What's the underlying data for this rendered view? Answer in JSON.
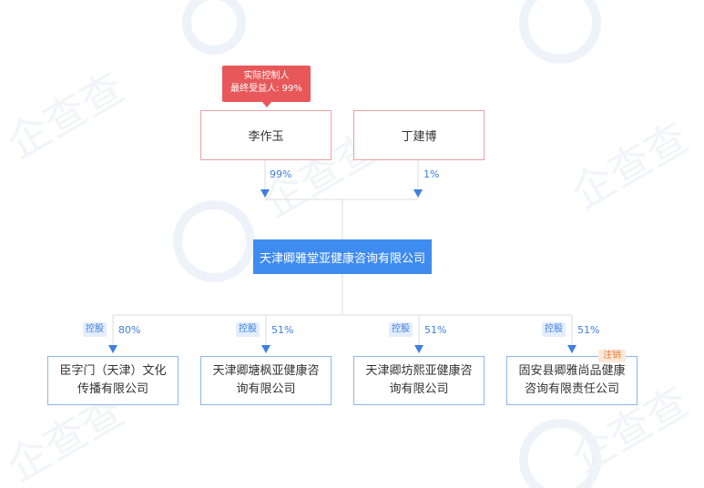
{
  "controller_tag": {
    "line1": "实际控制人",
    "line2": "最终受益人: 99%"
  },
  "shareholders": [
    {
      "name": "李作玉",
      "percent": "99%"
    },
    {
      "name": "丁建博",
      "percent": "1%"
    }
  ],
  "main_company": {
    "name": "天津卿雅堂亚健康咨询有限公司"
  },
  "subsidiaries": [
    {
      "relation": "控股",
      "percent": "80%",
      "name": "臣字门（天津）文化传播有限公司",
      "status": ""
    },
    {
      "relation": "控股",
      "percent": "51%",
      "name": "天津卿塘枫亚健康咨询有限公司",
      "status": ""
    },
    {
      "relation": "控股",
      "percent": "51%",
      "name": "天津卿坊熙亚健康咨询有限公司",
      "status": ""
    },
    {
      "relation": "控股",
      "percent": "51%",
      "name": "固安县卿雅尚品健康咨询有限责任公司",
      "status": "注销"
    }
  ],
  "colors": {
    "person_border": "#f0a0a2",
    "controller_tag_bg": "#e8585a",
    "main_company_bg": "#3f8cf0",
    "subsidiary_border": "#8db6ef",
    "percent_text": "#3d7fe0",
    "status_text": "#f07b2f"
  }
}
